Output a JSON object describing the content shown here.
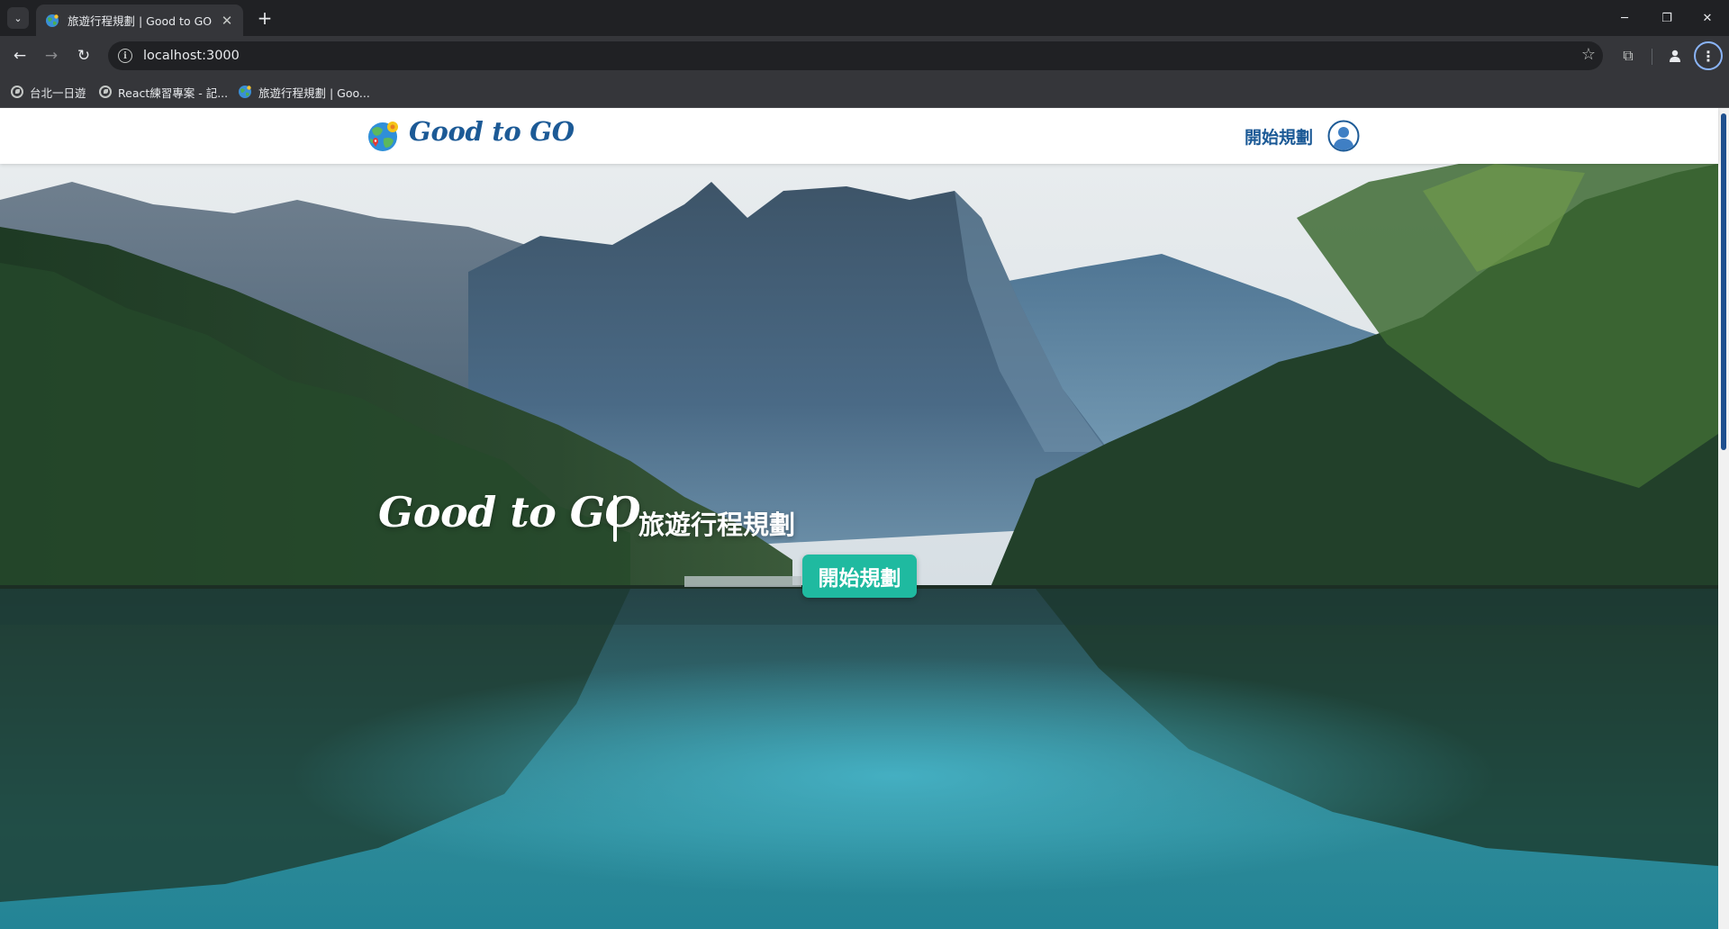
{
  "browser": {
    "tab": {
      "title": "旅遊行程規劃 | Good to GO",
      "close_glyph": "✕"
    },
    "tab_search_glyph": "⌄",
    "new_tab_glyph": "+",
    "window_controls": {
      "minimize": "─",
      "restore": "❐",
      "close": "✕"
    },
    "toolbar": {
      "back_glyph": "←",
      "forward_glyph": "→",
      "reload_glyph": "↻",
      "site_info_glyph": "i",
      "url": "localhost:3000",
      "star_glyph": "☆",
      "extensions_glyph": "⧉",
      "profile_glyph": "👤",
      "menu_glyph": "⋮"
    },
    "bookmarks": [
      {
        "label": "台北一日遊",
        "icon": "globe-icon"
      },
      {
        "label": "React練習專案 - 記...",
        "icon": "globe-icon"
      },
      {
        "label": "旅遊行程規劃 | Goo...",
        "icon": "site-favicon-icon"
      }
    ]
  },
  "site": {
    "brand": "Good to GO",
    "header_cta": "開始規劃",
    "hero": {
      "title": "Good to GO",
      "subtitle": "旅遊行程規劃",
      "button": "開始規劃"
    }
  },
  "colors": {
    "brand_blue": "#1c5a96",
    "cta_teal": "#1fbaa0"
  }
}
